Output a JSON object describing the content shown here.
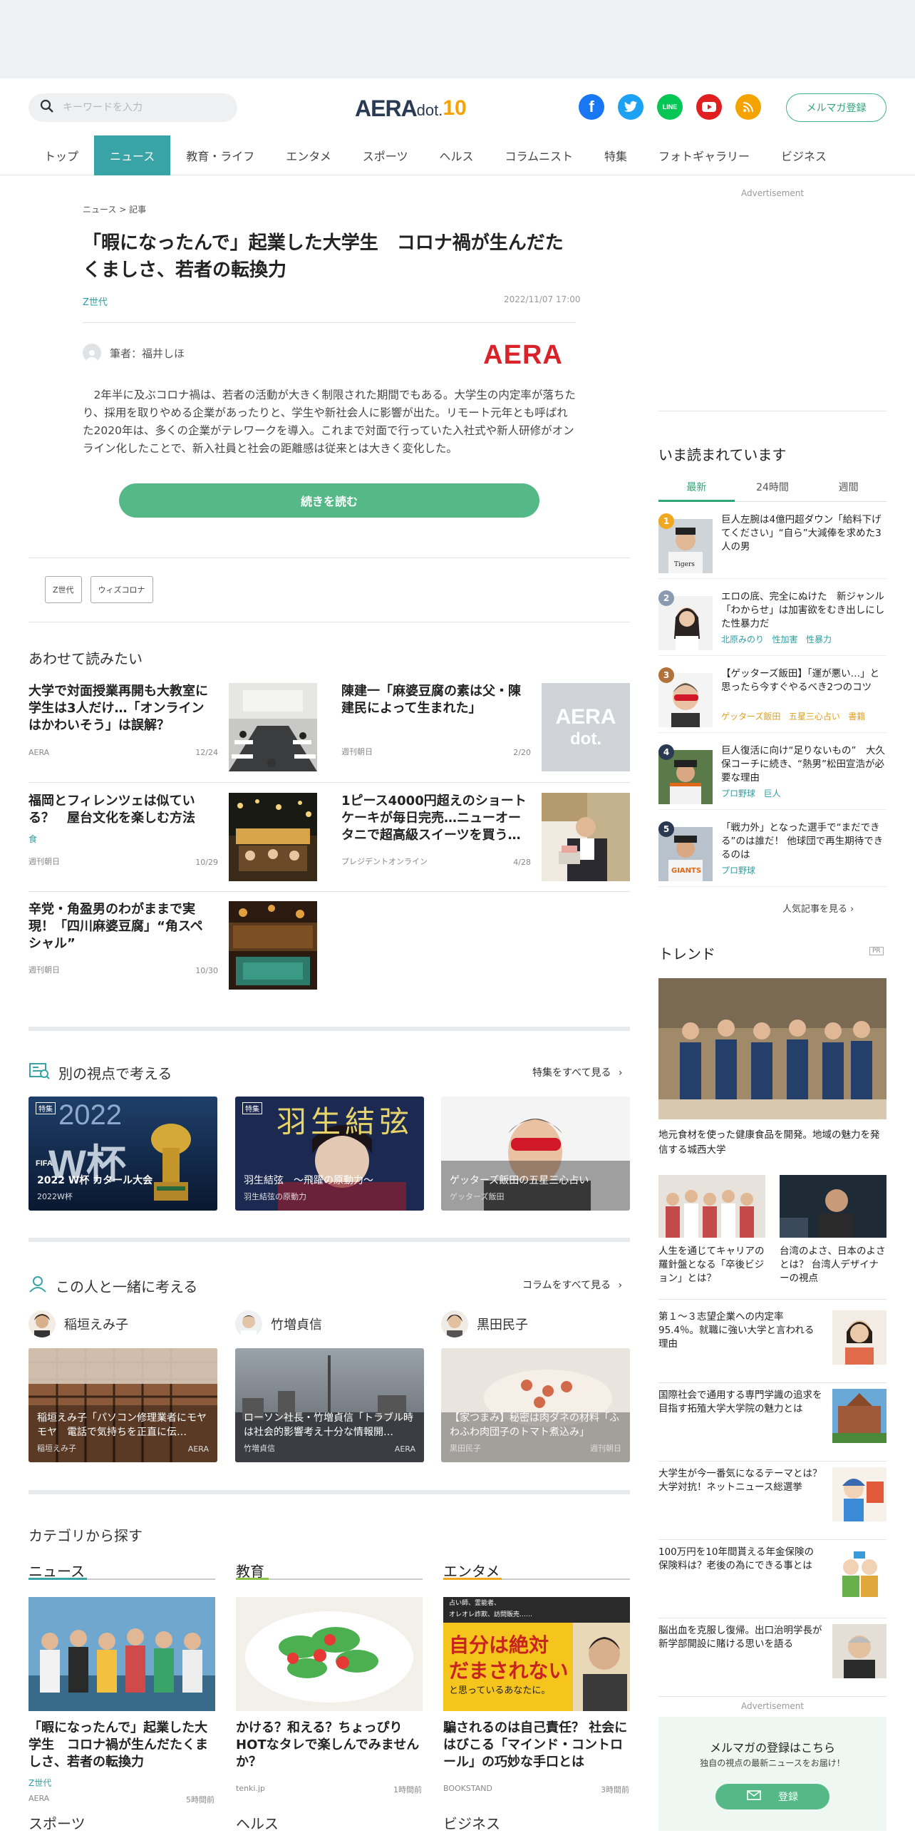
{
  "header": {
    "search_placeholder": "キーワードを入力",
    "logo_main": "AERA",
    "logo_sub": "dot.",
    "logo_anniv": "10",
    "social": [
      "facebook-icon",
      "twitter-icon",
      "line-icon",
      "youtube-icon",
      "rss-icon"
    ],
    "newsletter_button": "メルマガ登録",
    "nav": [
      "トップ",
      "ニュース",
      "教育・ライフ",
      "エンタメ",
      "スポーツ",
      "ヘルス",
      "コラムニスト",
      "特集",
      "フォトギャラリー",
      "ビジネス"
    ],
    "nav_active": 1
  },
  "article": {
    "breadcrumb": "ニュース > 記事",
    "title": "「暇になったんで」起業した大学生　コロナ禍が生んだたくましさ、若者の転換力",
    "tag": "Z世代",
    "date": "2022/11/07 17:00",
    "author": "筆者：福井しほ",
    "publisher_logo": "AERA",
    "lead": "　2年半に及ぶコロナ禍は、若者の活動が大きく制限された期間でもある。大学生の内定率が落ちたり、採用を取りやめる企業があったりと、学生や新社会人に影響が出た。リモート元年とも呼ばれた2020年は、多くの企業がテレワークを導入。これまで対面で行っていた入社式や新人研修がオンライン化したことで、新入社員と社会の距離感は従来とは大きく変化した。",
    "read_more": "続きを読む",
    "chips": [
      "Z世代",
      "ウィズコロナ"
    ]
  },
  "related": {
    "heading": "あわせて読みたい",
    "items": [
      {
        "title": "大学で対面授業再開も大教室に学生は3人だけ…「オンラインはかわいそう」は誤解？",
        "tag": "",
        "source": "AERA",
        "date": "12/24"
      },
      {
        "title": "陳建一「麻婆豆腐の素は父・陳建民によって生まれた」",
        "tag": "",
        "source": "週刊朝日",
        "date": "2/20"
      },
      {
        "title": "福岡とフィレンツェは似ている？　屋台文化を楽しむ方法",
        "tag": "食",
        "source": "週刊朝日",
        "date": "10/29"
      },
      {
        "title": "1ピース4000円超えのショートケーキが毎日完売…ニューオータニで超高級スイーツを買う…",
        "tag": "",
        "source": "プレジデントオンライン",
        "date": "4/28"
      },
      {
        "title": "辛党・角盈男のわがままで実現！「四川麻婆豆腐」“角スペシャル”",
        "tag": "",
        "source": "週刊朝日",
        "date": "10/30"
      }
    ],
    "placeholder_logo_1": "AERA",
    "placeholder_logo_2": "dot."
  },
  "perspective": {
    "heading": "別の視点で考える",
    "see_all": "特集をすべて見る",
    "cards": [
      {
        "title": "2022 W杯 カタール大会",
        "sub": "2022W杯",
        "overlay_year": "2022",
        "overlay_big": "W杯",
        "overlay_label": "FIFA",
        "overlay_tag": "特集"
      },
      {
        "title": "羽生結弦　～飛躍の原動力～",
        "sub": "羽生結弦の原動力",
        "overlay_big": "羽生結弦",
        "overlay_tag": "特集"
      },
      {
        "title": "ゲッターズ飯田の五星三心占い",
        "sub": "ゲッターズ飯田"
      }
    ]
  },
  "people": {
    "heading": "この人と一緒に考える",
    "see_all": "コラムをすべて見る",
    "items": [
      {
        "name": "稲垣えみ子",
        "title": "稲垣えみ子「パソコン修理業者にモヤモヤ　電話で気持ちを正直に伝…",
        "author": "稲垣えみ子",
        "source": "AERA"
      },
      {
        "name": "竹増貞信",
        "title": "ローソン社長・竹増貞信「トラブル時は社会的影響考え十分な情報開…",
        "author": "竹増貞信",
        "source": "AERA"
      },
      {
        "name": "黒田民子",
        "title": "【家つまみ】秘密は肉ダネの材料「ふわふわ肉団子のトマト煮込み」",
        "author": "黒田民子",
        "source": "週刊朝日"
      }
    ]
  },
  "categories": {
    "heading": "カテゴリから探す",
    "items": [
      {
        "name": "ニュース",
        "title": "「暇になったんで」起業した大学生　コロナ禍が生んだたくましさ、若者の転換力",
        "tag": "Z世代",
        "source": "AERA",
        "date": "5時間前"
      },
      {
        "name": "教育",
        "title": "かける？和える？ちょっぴりHOTなタレで楽しんでみませんか？",
        "tag": "",
        "source": "tenki.jp",
        "date": "1時間前"
      },
      {
        "name": "エンタメ",
        "title": "騙されるのは自己責任？ 社会にはびこる「マインド・コントロール」の巧妙な手口とは",
        "tag": "",
        "source": "BOOKSTAND",
        "date": "3時間前"
      }
    ],
    "next_row": [
      "スポーツ",
      "ヘルス",
      "ビジネス"
    ],
    "book_cover_lines": [
      "占い師、霊能者、",
      "オレオレ詐欺、訪問販売……",
      "自分は絶対",
      "だまされない",
      "と思っているあなたに。"
    ]
  },
  "sidebar": {
    "ad_label_1": "Advertisement",
    "ranking_heading": "いま読まれています",
    "tabs": [
      "最新",
      "24時間",
      "週間"
    ],
    "ranking": [
      {
        "num": "1",
        "title": "巨人左腕は4億円超ダウン「給料下げてください」“自ら”大減俸を求めた3人の男",
        "tags": [],
        "color": "#f0a81e"
      },
      {
        "num": "2",
        "title": "エロの底、完全にぬけた　新ジャンル「わからせ」は加害欲をむき出しにした性暴力だ",
        "tags": [
          "北原みのり",
          "性加害",
          "性暴力"
        ],
        "color": "#8a9bb0"
      },
      {
        "num": "3",
        "title": "【ゲッターズ飯田】「運が悪い…」と思ったら今すぐやるべき2つのコツ",
        "tags": [
          "ゲッターズ飯田",
          "五星三心占い",
          "書籍"
        ],
        "color": "#b0723a"
      },
      {
        "num": "4",
        "title": "巨人復活に向け“足りないもの”　大久保コーチに続き、“熱男”松田宣浩が必要な理由",
        "tags": [
          "プロ野球",
          "巨人"
        ],
        "color": "#2a3a52"
      },
      {
        "num": "5",
        "title": "「戦力外」となった選手で“まだできる”のは誰だ！ 他球団で再生期待できるのは",
        "tags": [
          "プロ野球"
        ],
        "color": "#2a3a52"
      }
    ],
    "ranking_more": "人気記事を見る",
    "trend_heading": "トレンド",
    "pr_label": "PR",
    "trend_main": "地元食材を使った健康食品を開発。地域の魅力を発信する城西大学",
    "trend_pair": [
      "人生を通じてキャリアの羅針盤となる「卒後ビジョン」とは？",
      "台湾のよさ、日本のよさとは？ 台湾人デザイナーの視点"
    ],
    "trend_list": [
      "第１～３志望企業への内定率95.4％。就職に強い大学と言われる理由",
      "国際社会で通用する専門学識の追求を目指す拓殖大学大学院の魅力とは",
      "大学生が今一番気になるテーマとは？大学対抗！ネットニュース総選挙",
      "100万円を10年間貰える年金保険の保険料は？老後の為にできる事とは",
      "脳出血を克服し復帰。出口治明学長が新学部開設に賭ける思いを語る"
    ],
    "ad_label_2": "Advertisement",
    "magazine_title": "メルマガの登録はこちら",
    "magazine_sub": "独自の視点の最新ニュースをお届け！",
    "magazine_button": "登録"
  },
  "colors": {
    "accent": "#3aa3a6",
    "green": "#55b987",
    "ranking_tag": "#2c9fa3",
    "ranking_tag_orange": "#e0a020"
  }
}
